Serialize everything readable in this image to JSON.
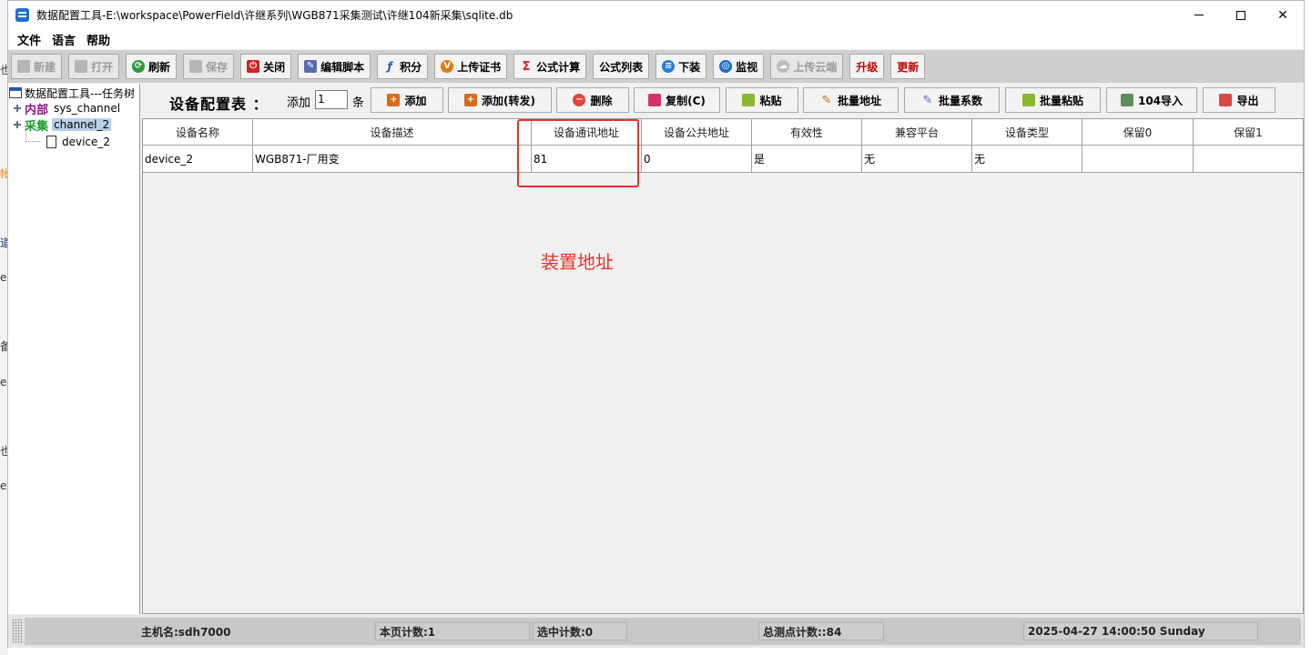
{
  "window": {
    "title": "数据配置工具-E:\\workspace\\PowerField\\许继系列\\WGB871采集测试\\许继104新采集\\sqlite.db",
    "minimize_glyph": "—",
    "close_glyph": "✕"
  },
  "background_chars": [
    "也",
    "帐",
    "道",
    "e",
    "备",
    "e",
    "也",
    "e"
  ],
  "menu": {
    "items": [
      "文件",
      "语言",
      "帮助"
    ]
  },
  "toolbar": {
    "buttons": [
      {
        "label": "新建",
        "enabled": false,
        "icon": "folder-icon"
      },
      {
        "label": "打开",
        "enabled": false,
        "icon": "open-icon"
      },
      {
        "label": "刷新",
        "enabled": true,
        "icon": "refresh-icon"
      },
      {
        "label": "保存",
        "enabled": false,
        "icon": "save-icon"
      },
      {
        "label": "关闭",
        "enabled": true,
        "icon": "power-icon"
      },
      {
        "label": "编辑脚本",
        "enabled": true,
        "icon": "script-icon"
      },
      {
        "label": "积分",
        "enabled": true,
        "icon": "integral-icon"
      },
      {
        "label": "上传证书",
        "enabled": true,
        "icon": "certificate-icon"
      },
      {
        "label": "公式计算",
        "enabled": true,
        "icon": "formula-icon"
      },
      {
        "label": "公式列表",
        "enabled": true,
        "icon": ""
      },
      {
        "label": "下装",
        "enabled": true,
        "icon": "list-icon"
      },
      {
        "label": "监视",
        "enabled": true,
        "icon": "monitor-icon"
      },
      {
        "label": "上传云端",
        "enabled": false,
        "icon": "cloud-icon"
      },
      {
        "label": "升级",
        "enabled": true,
        "icon": ""
      },
      {
        "label": "更新",
        "enabled": true,
        "icon": ""
      }
    ]
  },
  "tree": {
    "root": "数据配置工具---任务树",
    "internal_label": "内部",
    "internal_channel": "sys_channel",
    "collect_label": "采集",
    "collect_channel": "channel_2",
    "device": "device_2"
  },
  "config": {
    "title": "设备配置表 ：",
    "add_label": "添加",
    "add_count": "1",
    "add_unit": "条",
    "buttons": {
      "add": "添加",
      "add_forward": "添加(转发)",
      "delete": "删除",
      "copy": "复制(C)",
      "paste": "粘贴",
      "batch_address": "批量地址",
      "batch_coef": "批量系数",
      "batch_paste": "批量粘贴",
      "import104": "104导入",
      "export": "导出"
    }
  },
  "table": {
    "columns": [
      "设备名称",
      "设备描述",
      "设备通讯地址",
      "设备公共地址",
      "有效性",
      "兼容平台",
      "设备类型",
      "保留0",
      "保留1"
    ],
    "rows": [
      [
        "device_2",
        "WGB871-厂用变",
        "81",
        "0",
        "是",
        "无",
        "无",
        "",
        ""
      ]
    ]
  },
  "annotation": {
    "text": "装置地址",
    "color": "#e8322b"
  },
  "status": {
    "host": "主机名:sdh7000",
    "page_count": "本页计数:1",
    "selected_count": "选中计数:0",
    "total_points": "总测点计数::84",
    "datetime": "2025-04-27 14:00:50 Sunday"
  }
}
